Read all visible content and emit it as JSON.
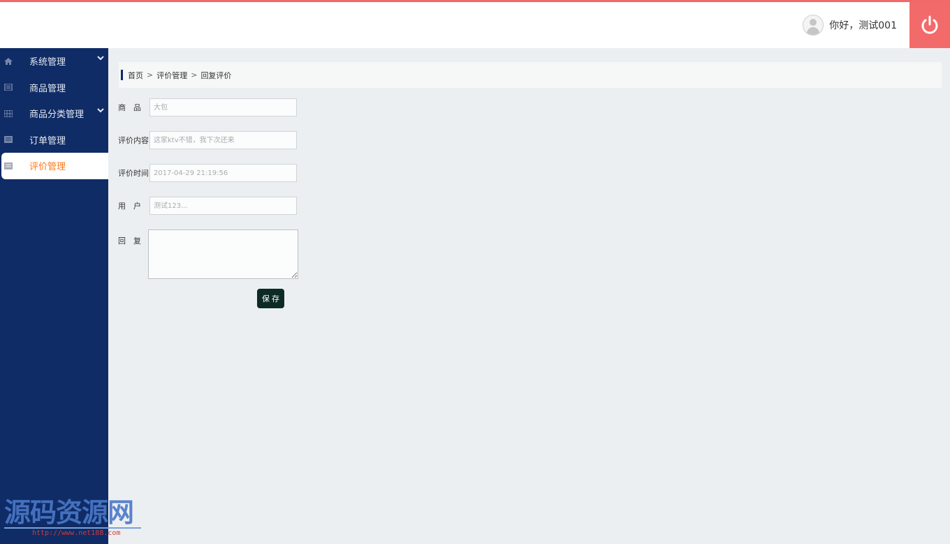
{
  "header": {
    "greeting": "你好，测试001"
  },
  "sidebar": {
    "items": [
      {
        "label": "系统管理",
        "has_submenu": true,
        "active": false
      },
      {
        "label": "商品管理",
        "has_submenu": false,
        "active": false
      },
      {
        "label": "商品分类管理",
        "has_submenu": true,
        "active": false
      },
      {
        "label": "订单管理",
        "has_submenu": false,
        "active": false
      },
      {
        "label": "评价管理",
        "has_submenu": false,
        "active": true
      }
    ]
  },
  "breadcrumb": {
    "items": [
      "首页",
      "评价管理",
      "回复评价"
    ],
    "separator": ">"
  },
  "form": {
    "product": {
      "label": "商　品",
      "placeholder": "大包"
    },
    "content": {
      "label": "评价内容",
      "placeholder": "这家ktv不错，我下次还来"
    },
    "time": {
      "label": "评价时间",
      "placeholder": "2017-04-29 21:19:56"
    },
    "user": {
      "label": "用　户",
      "placeholder": "测试123..."
    },
    "reply": {
      "label": "回　复",
      "value": ""
    },
    "save_label": "保存"
  },
  "watermark": {
    "title": "源码资源网",
    "url": "http://www.net188.com"
  },
  "colors": {
    "sidebar_bg": "#0f2c66",
    "active_text": "#ff7a1a",
    "power_button": "#f36a6a",
    "save_button": "#0d2b26",
    "page_bg": "#eceff1"
  }
}
